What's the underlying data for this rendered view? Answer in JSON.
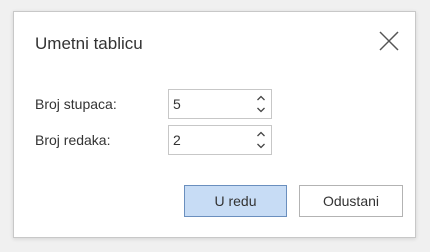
{
  "dialog": {
    "title": "Umetni tablicu",
    "close_icon": "close-icon",
    "fields": {
      "columns": {
        "label": "Broj stupaca:",
        "value": "5"
      },
      "rows": {
        "label": "Broj redaka:",
        "value": "2"
      }
    },
    "buttons": {
      "ok_label": "U redu",
      "cancel_label": "Odustani"
    }
  },
  "colors": {
    "ok_button_bg": "#c7dcf5",
    "ok_button_border": "#6a8fbe"
  }
}
